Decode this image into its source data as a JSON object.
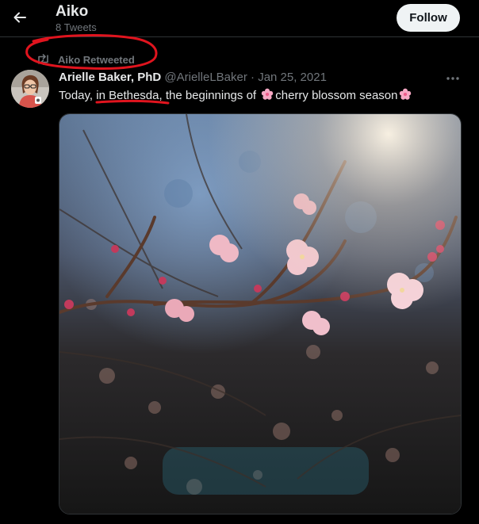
{
  "header": {
    "title": "Aiko",
    "subtitle": "8 Tweets",
    "follow_label": "Follow"
  },
  "retweet": {
    "label": "Aiko Retweeted"
  },
  "tweet": {
    "author": "Arielle Baker, PhD",
    "handle": "@ArielleLBaker",
    "separator": "·",
    "date": "Jan 25, 2021",
    "text_before": "Today, ",
    "text_underlined": "in Bethesda,",
    "text_middle": " the beginnings of ",
    "text_after": "cherry blossom season",
    "emoji": "cherry-blossom-icon"
  },
  "colors": {
    "background": "#000000",
    "primary_text": "#e7e9ea",
    "secondary_text": "#71767b",
    "follow_bg": "#eff3f4",
    "annotation": "#e0141e"
  }
}
